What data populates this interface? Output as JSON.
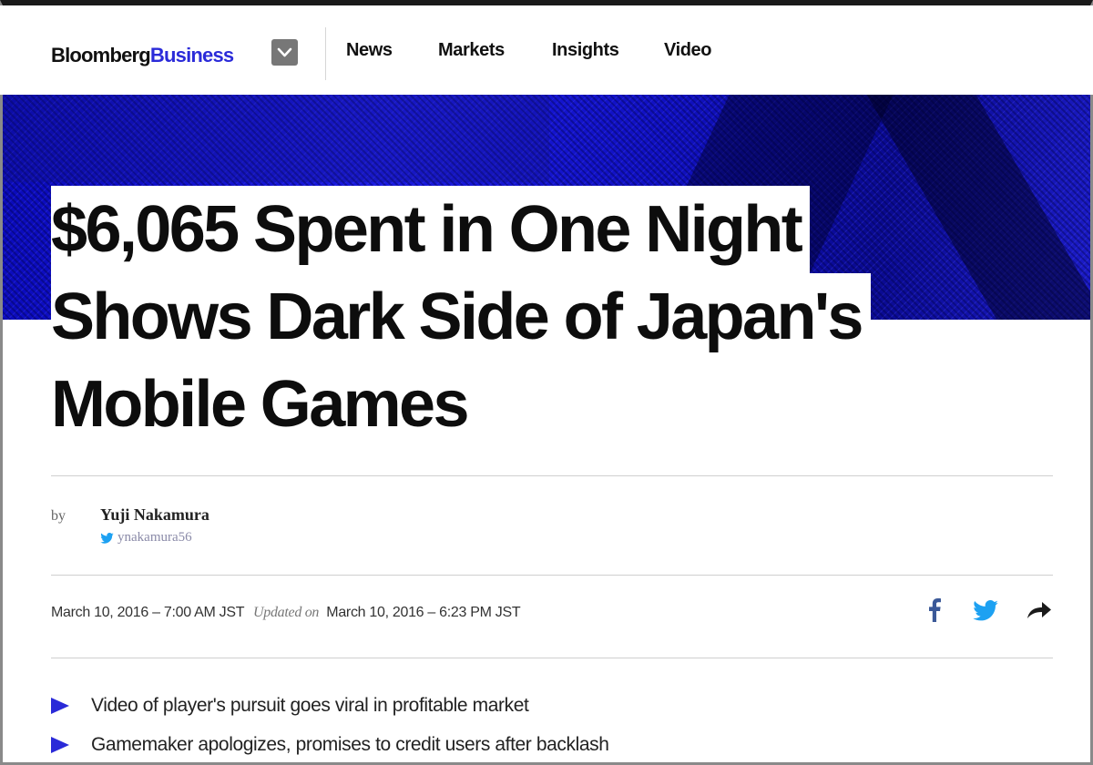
{
  "header": {
    "logo_brand": "Bloomberg",
    "logo_sub": "Business",
    "nav": [
      {
        "label": "News"
      },
      {
        "label": "Markets"
      },
      {
        "label": "Insights"
      },
      {
        "label": "Video"
      }
    ]
  },
  "article": {
    "headline_lines": [
      "$6,065 Spent in One Night",
      "Shows Dark Side of Japan's",
      "Mobile Games"
    ],
    "by_label": "by",
    "author": "Yuji Nakamura",
    "author_handle": "ynakamura56",
    "published": "March 10, 2016 – 7:00 AM JST",
    "updated_label": "Updated on",
    "updated": "March 10, 2016 – 6:23 PM JST",
    "bullets": [
      "Video of player's pursuit goes viral in profitable market",
      "Gamemaker apologizes, promises to credit users after backlash"
    ]
  },
  "share": {
    "icons": [
      "facebook-icon",
      "twitter-icon",
      "share-arrow-icon"
    ]
  },
  "colors": {
    "accent": "#2b2bd9",
    "hero_blue": "#1414c8",
    "facebook": "#3b5998",
    "twitter": "#1da1f2"
  }
}
